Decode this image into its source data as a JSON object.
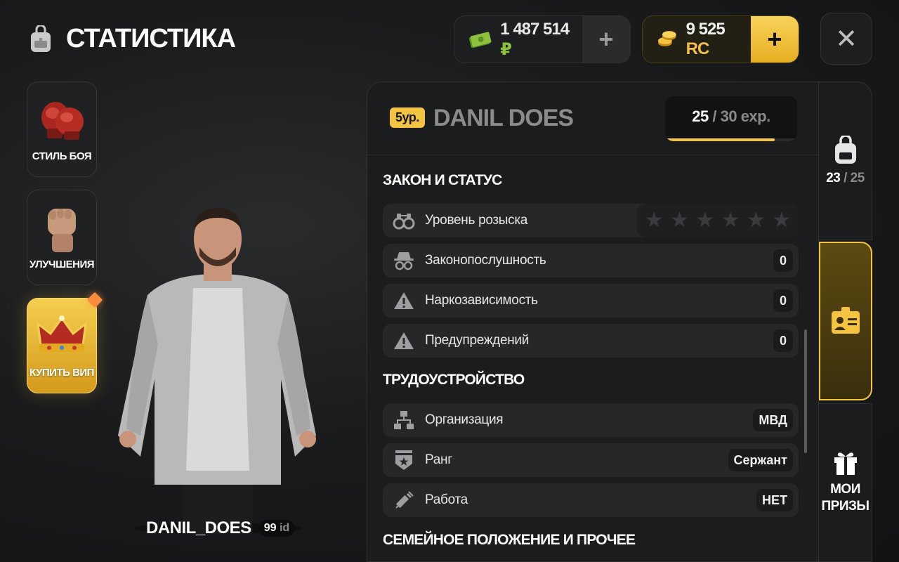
{
  "header": {
    "title": "СТАТИСТИКА",
    "rub_amount": "1 487 514",
    "rub_sign": "₽",
    "rc_amount": "9 525",
    "rc_sign": "RC",
    "plus": "+",
    "close": "✕"
  },
  "sidebar": {
    "items": [
      {
        "label": "СТИЛЬ БОЯ",
        "icon": "boxing-gloves-icon"
      },
      {
        "label": "УЛУЧШЕНИЯ",
        "icon": "fist-icon"
      },
      {
        "label": "КУПИТЬ ВИП",
        "icon": "crown-icon"
      }
    ]
  },
  "character": {
    "name": "DANIL_DOES",
    "id_num": "99",
    "id_suffix": "id"
  },
  "panel": {
    "level_badge": "5ур.",
    "player_name": "DANIL DOES",
    "exp_current": "25",
    "exp_sep": " / ",
    "exp_max": "30 exp.",
    "exp_progress": 0.83,
    "sections": {
      "law": "ЗАКОН И СТАТУС",
      "job": "ТРУДОУСТРОЙСТВО",
      "family": "СЕМЕЙНОЕ ПОЛОЖЕНИЕ И ПРОЧЕЕ"
    },
    "rows": {
      "wanted": {
        "label": "Уровень розыска",
        "stars": 6,
        "filled": 0
      },
      "lawful": {
        "label": "Законопослушность",
        "value": "0"
      },
      "drugs": {
        "label": "Наркозависимость",
        "value": "0"
      },
      "warnings": {
        "label": "Предупреждений",
        "value": "0"
      },
      "org": {
        "label": "Организация",
        "value": "МВД"
      },
      "rank": {
        "label": "Ранг",
        "value": "Сержант"
      },
      "work": {
        "label": "Работа",
        "value": "НЕТ"
      }
    }
  },
  "tabs": {
    "inventory_current": "23",
    "inventory_sep": " / ",
    "inventory_max": "25",
    "gift_line1": "МОИ",
    "gift_line2": "ПРИЗЫ"
  },
  "colors": {
    "accent": "#f4c440",
    "money_green": "#8ec23d"
  }
}
